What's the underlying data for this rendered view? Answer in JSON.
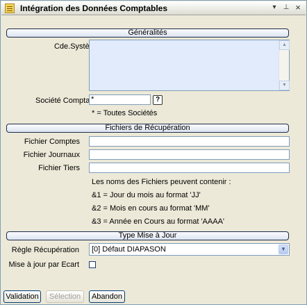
{
  "window": {
    "title": "Intégration des Données Comptables",
    "controls": {
      "dropdown": "▾",
      "pin": "⊥",
      "close": "×"
    }
  },
  "sections": {
    "general": "Généralités",
    "files": "Fichiers de Récupération",
    "update_type": "Type Mise à Jour"
  },
  "general": {
    "cde_systeme_label": "Cde.Système",
    "cde_systeme_value": "",
    "societe_label": "Société Comptable",
    "societe_value": "*",
    "help_label": "?",
    "societe_note": "* = Toutes Sociétés"
  },
  "files": {
    "comptes_label": "Fichier Comptes",
    "comptes_value": "",
    "journaux_label": "Fichier Journaux",
    "journaux_value": "",
    "tiers_label": "Fichier Tiers",
    "tiers_value": "",
    "notes": [
      "Les noms des Fichiers peuvent contenir :",
      "&1 = Jour du mois au format 'JJ'",
      "&2 = Mois en cours au format 'MM'",
      "&3 = Année en Cours au format 'AAAA'"
    ]
  },
  "update": {
    "regle_label": "Règle Récupération",
    "regle_value": "[0] Défaut DIAPASON",
    "ecart_label": "Mise à jour par Ecart",
    "ecart_checked": false
  },
  "buttons": {
    "validation": "Validation",
    "selection": "Sélection",
    "abandon": "Abandon"
  }
}
